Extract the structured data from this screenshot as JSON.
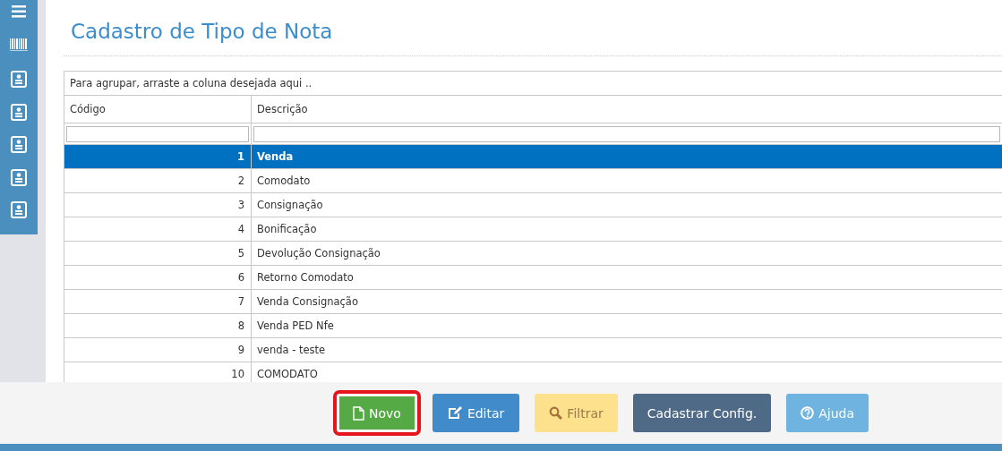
{
  "sidebar": {
    "items": [
      {
        "kind": "menu"
      },
      {
        "kind": "barcode"
      },
      {
        "kind": "card"
      },
      {
        "kind": "card"
      },
      {
        "kind": "card"
      },
      {
        "kind": "card"
      },
      {
        "kind": "card"
      }
    ]
  },
  "title": "Cadastro de Tipo de Nota",
  "grid": {
    "group_hint": "Para agrupar, arraste a coluna desejada aqui ..",
    "columns": [
      "Código",
      "Descrição"
    ],
    "rows": [
      {
        "code": "1",
        "description": "Venda",
        "selected": true
      },
      {
        "code": "2",
        "description": "Comodato",
        "selected": false
      },
      {
        "code": "3",
        "description": "Consignação",
        "selected": false
      },
      {
        "code": "4",
        "description": "Bonificação",
        "selected": false
      },
      {
        "code": "5",
        "description": "Devolução Consignação",
        "selected": false
      },
      {
        "code": "6",
        "description": "Retorno Comodato",
        "selected": false
      },
      {
        "code": "7",
        "description": "Venda Consignação",
        "selected": false
      },
      {
        "code": "8",
        "description": "Venda PED Nfe",
        "selected": false
      },
      {
        "code": "9",
        "description": "venda - teste",
        "selected": false
      },
      {
        "code": "10",
        "description": "COMODATO",
        "selected": false
      }
    ]
  },
  "buttons": [
    {
      "label": "Novo",
      "kind": "new",
      "highlighted": true
    },
    {
      "label": "Editar",
      "kind": "edit",
      "highlighted": false
    },
    {
      "label": "Filtrar",
      "kind": "filter",
      "highlighted": false
    },
    {
      "label": "Cadastrar Config.",
      "kind": "config",
      "highlighted": false
    },
    {
      "label": "Ajuda",
      "kind": "help",
      "highlighted": false
    }
  ]
}
